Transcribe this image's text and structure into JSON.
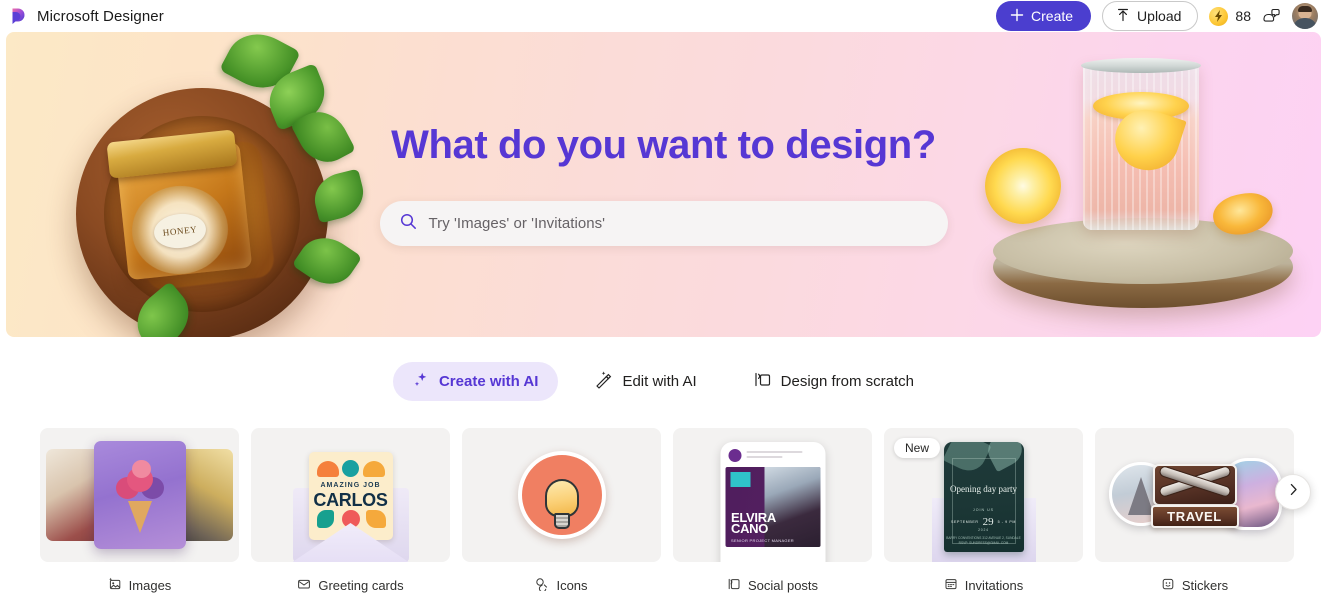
{
  "app": {
    "title": "Microsoft Designer",
    "logo_icon": "designer-logo-icon"
  },
  "topbar": {
    "create_label": "Create",
    "create_icon": "plus-icon",
    "upload_label": "Upload",
    "upload_icon": "upload-arrow-icon",
    "credits_value": "88",
    "credits_icon": "lightning-coin-icon",
    "feedback_icon": "feedback-chat-icon",
    "avatar_icon": "user-avatar"
  },
  "hero": {
    "title": "What do you want to design?",
    "search_placeholder": "Try 'Images' or 'Invitations'",
    "search_icon": "search-icon",
    "left_art_label": "HONEY",
    "accent_color": "#5637d4"
  },
  "modes": [
    {
      "label": "Create with AI",
      "icon": "sparkle-icon",
      "active": true
    },
    {
      "label": "Edit with AI",
      "icon": "magic-wand-icon",
      "active": false
    },
    {
      "label": "Design from scratch",
      "icon": "blank-canvas-icon",
      "active": false
    }
  ],
  "cards": [
    {
      "label": "Images",
      "icon": "image-sparkle-icon",
      "badge": "",
      "art": "ice-cream-image-stack"
    },
    {
      "label": "Greeting cards",
      "icon": "envelope-icon",
      "badge": "",
      "art": "greeting-card-envelope",
      "art_text_top": "AMAZING JOB",
      "art_text_main": "CARLOS"
    },
    {
      "label": "Icons",
      "icon": "icons-shapes-icon",
      "badge": "",
      "art": "lightbulb-icon-sticker"
    },
    {
      "label": "Social posts",
      "icon": "social-post-icon",
      "badge": "",
      "art": "instagram-phone-post",
      "art_name_line1": "ELVIRA",
      "art_name_line2": "CANO",
      "art_subtitle": "SENIOR PROJECT MANAGER"
    },
    {
      "label": "Invitations",
      "icon": "invitation-card-icon",
      "badge": "New",
      "art": "opening-day-party-invitation",
      "art_title": "Opening day party",
      "art_kicker": "JOIN US",
      "art_month": "SEPTEMBER",
      "art_day": "29",
      "art_time": "5 - 9 PM",
      "art_year": "2024",
      "art_footer": "BARRY CONVENTIONS\n312 AVENUE 2, SUNDALE\nRSVP: SUNDRESS@GMAIL.COM"
    },
    {
      "label": "Stickers",
      "icon": "sticker-smiley-icon",
      "badge": "",
      "art": "travel-sticker-pack",
      "art_text": "TRAVEL"
    }
  ],
  "carousel": {
    "next_label": "Next",
    "next_icon": "chevron-right-icon"
  }
}
